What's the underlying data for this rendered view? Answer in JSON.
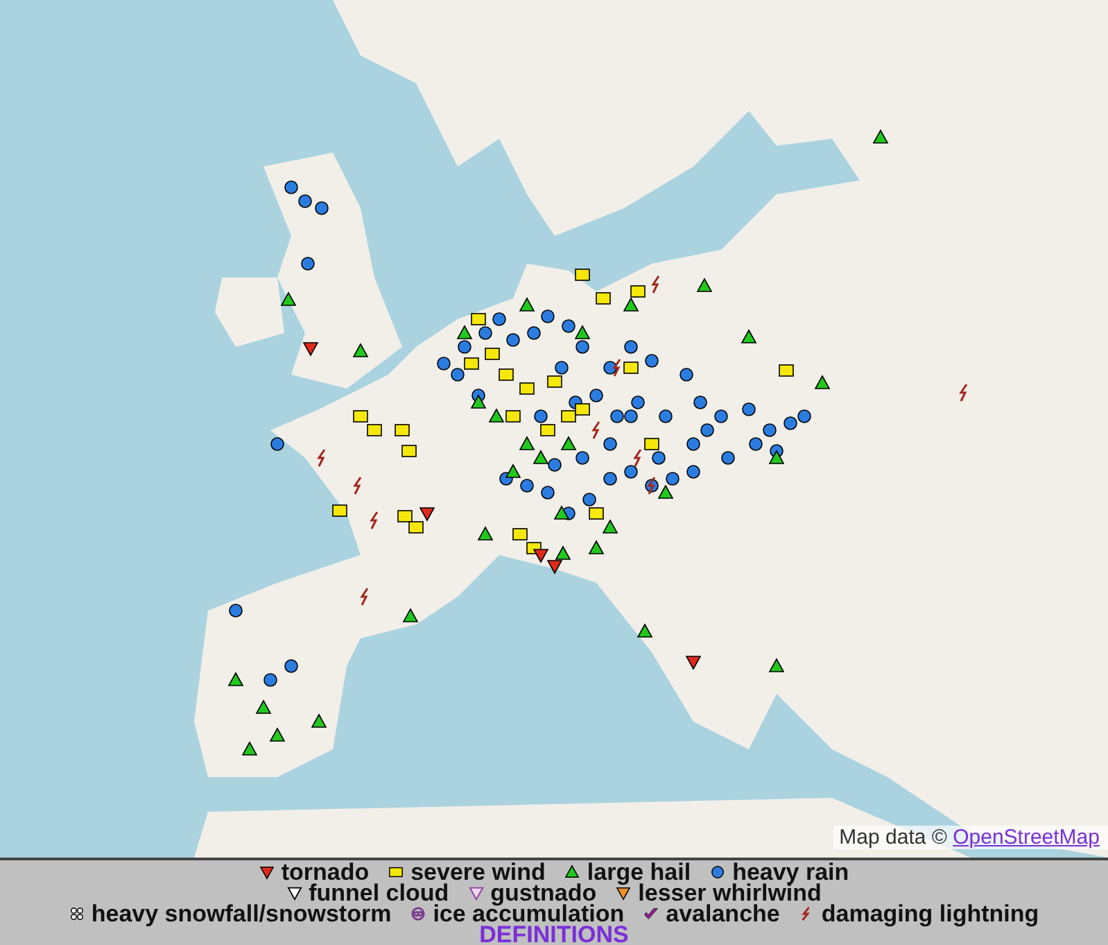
{
  "map": {
    "attribution": {
      "prefix": "Map data ©",
      "link": "OpenStreetMap"
    }
  },
  "legend": {
    "rows": [
      [
        {
          "kind": "tornado",
          "label": "tornado"
        },
        {
          "kind": "severe-wind",
          "label": "severe wind"
        },
        {
          "kind": "large-hail",
          "label": "large hail"
        },
        {
          "kind": "heavy-rain",
          "label": "heavy rain"
        }
      ],
      [
        {
          "kind": "funnel-cloud",
          "label": "funnel cloud"
        },
        {
          "kind": "gustnado",
          "label": "gustnado"
        },
        {
          "kind": "lesser-whirlwind",
          "label": "lesser whirlwind"
        }
      ],
      [
        {
          "kind": "snowfall",
          "label": "heavy snowfall/snowstorm"
        },
        {
          "kind": "ice",
          "label": "ice accumulation"
        },
        {
          "kind": "avalanche",
          "label": "avalanche"
        },
        {
          "kind": "lightning",
          "label": "damaging lightning"
        }
      ]
    ],
    "definitions_link": "DEFINITIONS"
  }
}
